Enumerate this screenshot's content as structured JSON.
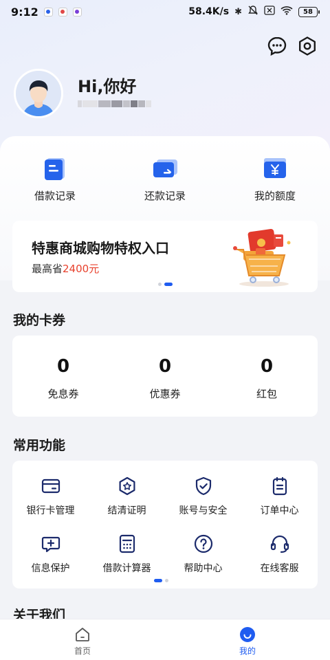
{
  "status_bar": {
    "time": "9:12",
    "net_speed": "58.4K/s",
    "battery": "58"
  },
  "profile": {
    "greeting": "Hi,你好"
  },
  "quick_actions": [
    {
      "label": "借款记录",
      "icon": "document-icon"
    },
    {
      "label": "还款记录",
      "icon": "card-icon"
    },
    {
      "label": "我的额度",
      "icon": "yen-wallet-icon"
    }
  ],
  "banner": {
    "title": "特惠商城购物特权入口",
    "subtitle_prefix": "最高省",
    "subtitle_amount": "2400元"
  },
  "coupons": {
    "title": "我的卡券",
    "items": [
      {
        "value": "0",
        "label": "免息券"
      },
      {
        "value": "0",
        "label": "优惠券"
      },
      {
        "value": "0",
        "label": "红包"
      }
    ]
  },
  "functions": {
    "title": "常用功能",
    "items": [
      {
        "label": "银行卡管理",
        "icon": "bank-card-icon"
      },
      {
        "label": "结清证明",
        "icon": "certificate-badge-icon"
      },
      {
        "label": "账号与安全",
        "icon": "shield-check-icon"
      },
      {
        "label": "订单中心",
        "icon": "clipboard-icon"
      },
      {
        "label": "信息保护",
        "icon": "message-plus-icon"
      },
      {
        "label": "借款计算器",
        "icon": "calculator-icon"
      },
      {
        "label": "帮助中心",
        "icon": "help-circle-icon"
      },
      {
        "label": "在线客服",
        "icon": "headset-icon"
      }
    ]
  },
  "about": {
    "title": "关于我们"
  },
  "bottom_nav": [
    {
      "label": "首页",
      "icon": "home-icon",
      "active": false
    },
    {
      "label": "我的",
      "icon": "profile-smile-icon",
      "active": true
    }
  ],
  "colors": {
    "accent": "#1f5cf0",
    "highlight_red": "#e8412d",
    "page_bg": "#f2f3f7"
  }
}
